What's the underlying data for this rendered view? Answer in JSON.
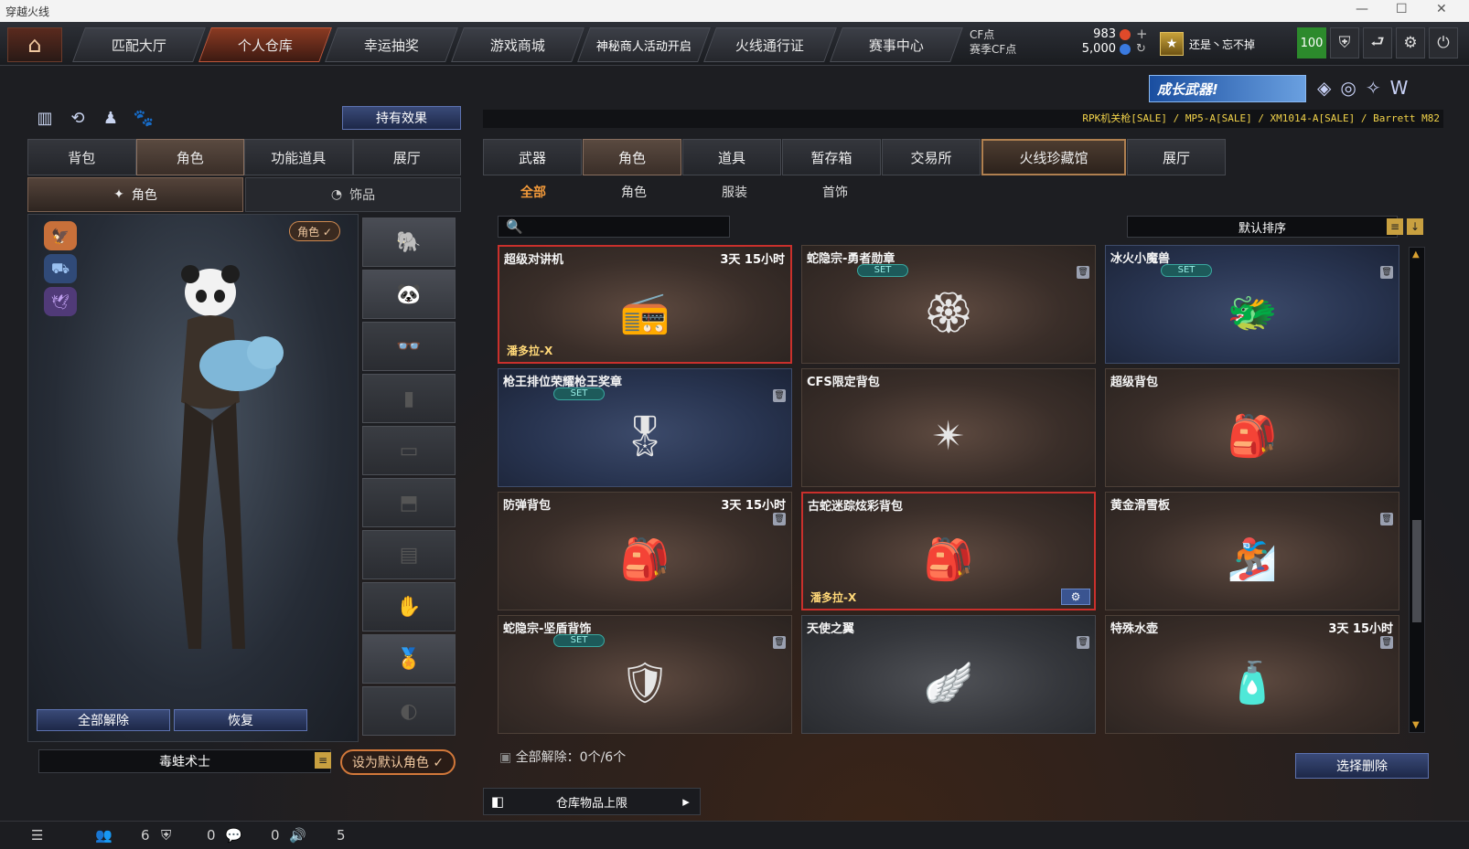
{
  "window": {
    "title": "穿越火线",
    "controls": [
      "—",
      "☐",
      "✕"
    ]
  },
  "topnav": {
    "tabs": [
      "匹配大厅",
      "个人仓库",
      "幸运抽奖",
      "游戏商城",
      "神秘商人活动开启",
      "火线通行证",
      "赛事中心"
    ],
    "active_tab": "个人仓库",
    "cf_label": "CF点",
    "season_cf_label": "赛季CF点",
    "cf_value": "983",
    "season_cf_value": "5,000",
    "username": "还是丶忘不掉",
    "level": "100"
  },
  "left": {
    "effect_button": "持有效果",
    "tabs": [
      "背包",
      "角色",
      "功能道具",
      "展厅"
    ],
    "active_tab": "角色",
    "subtabs": [
      "角色",
      "饰品"
    ],
    "role_tag": "角色 ✓",
    "unequip_all": "全部解除",
    "restore": "恢复",
    "role_name": "毒蛙术士",
    "set_default": "设为默认角色 ✓"
  },
  "right": {
    "banner": "成长武器!",
    "ticker": "RPK机关枪[SALE] / MP5-A[SALE] / XM1014-A[SALE] / Barrett M82",
    "tabs": [
      "武器",
      "角色",
      "道具",
      "暂存箱",
      "交易所",
      "火线珍藏馆",
      "展厅"
    ],
    "active_tab": "角色",
    "highlight_tab": "火线珍藏馆",
    "subtabs": [
      "全部",
      "角色",
      "服装",
      "首饰"
    ],
    "active_subtab": "全部",
    "search_placeholder": "",
    "sort_label": "默认排序",
    "items": [
      {
        "name": "超级对讲机",
        "time": "3天 15小时",
        "set": "",
        "owner": "潘多拉-X",
        "style": "sel",
        "icon": "📻"
      },
      {
        "name": "蛇隐宗-勇者勋章",
        "time": "",
        "set": "SET",
        "owner": "",
        "style": "normal",
        "icon": "🏵"
      },
      {
        "name": "冰火小魔兽",
        "time": "",
        "set": "SET",
        "owner": "",
        "style": "blue",
        "icon": "🐲"
      },
      {
        "name": "枪王排位荣耀枪王奖章",
        "time": "",
        "set": "SET",
        "owner": "",
        "style": "blue",
        "icon": "🎖"
      },
      {
        "name": "CFS限定背包",
        "time": "",
        "set": "",
        "owner": "",
        "style": "normal",
        "icon": "✴"
      },
      {
        "name": "超级背包",
        "time": "",
        "set": "",
        "owner": "",
        "style": "normal",
        "icon": "🎒"
      },
      {
        "name": "防弹背包",
        "time": "3天 15小时",
        "set": "",
        "owner": "",
        "style": "normal",
        "icon": "🎒"
      },
      {
        "name": "古蛇迷踪炫彩背包",
        "time": "",
        "set": "",
        "owner": "潘多拉-X",
        "style": "sel",
        "icon": "🎒"
      },
      {
        "name": "黄金滑雪板",
        "time": "",
        "set": "",
        "owner": "",
        "style": "normal",
        "icon": "🏂"
      },
      {
        "name": "蛇隐宗-坚盾背饰",
        "time": "",
        "set": "SET",
        "owner": "",
        "style": "normal",
        "icon": "🛡"
      },
      {
        "name": "天使之翼",
        "time": "",
        "set": "",
        "owner": "",
        "style": "gray",
        "icon": "🪽"
      },
      {
        "name": "特殊水壶",
        "time": "3天 15小时",
        "set": "",
        "owner": "",
        "style": "normal",
        "icon": "🧴"
      }
    ],
    "unequip_summary": "全部解除：0个/6个",
    "select_delete": "选择删除",
    "storage_limit": "仓库物品上限"
  },
  "statusbar": {
    "friends": "6",
    "guild": "0",
    "messages": "0",
    "volume": "5"
  }
}
